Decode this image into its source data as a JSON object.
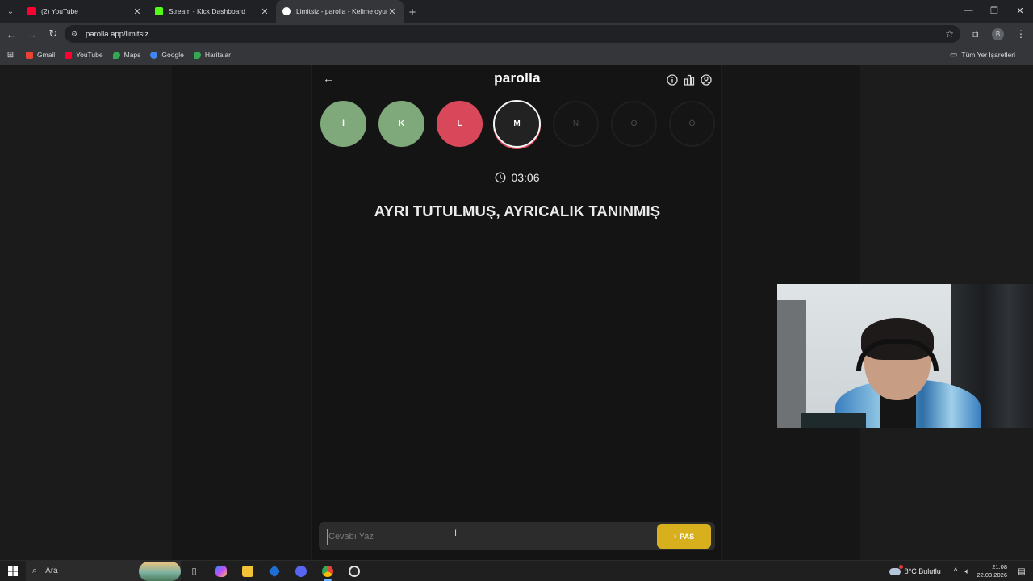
{
  "browser": {
    "tabs": [
      {
        "title": "(2) YouTube",
        "favicon_color": "#ff0033",
        "active": false
      },
      {
        "title": "Stream - Kick Dashboard",
        "favicon_color": "#53fc18",
        "active": false
      },
      {
        "title": "Limitsiz - parolla - Kelime oyunu",
        "favicon_color": "#ffffff",
        "active": true
      }
    ],
    "new_tab": "+",
    "url": "parolla.app/limitsiz",
    "profile_initial": "B",
    "bookmarks": [
      {
        "label": "Gmail",
        "color": "#ea4335"
      },
      {
        "label": "YouTube",
        "color": "#ff0033"
      },
      {
        "label": "Maps",
        "color": "#34a853"
      },
      {
        "label": "Google",
        "color": "#4285f4"
      },
      {
        "label": "Haritalar",
        "color": "#34a853"
      }
    ],
    "all_bookmarks": "Tüm Yer İşaretleri"
  },
  "app": {
    "logo": "parolla",
    "letters": [
      {
        "char": "İ",
        "state": "correct"
      },
      {
        "char": "K",
        "state": "correct"
      },
      {
        "char": "L",
        "state": "wrong"
      },
      {
        "char": "M",
        "state": "current"
      },
      {
        "char": "N",
        "state": "pending"
      },
      {
        "char": "O",
        "state": "pending"
      },
      {
        "char": "Ö",
        "state": "pending"
      }
    ],
    "timer": "03:06",
    "question": "AYRI TUTULMUŞ, AYRICALIK TANINMIŞ",
    "answer_placeholder": "Cevabı Yaz",
    "answer_value": "",
    "pass_label": "PAS",
    "colors": {
      "correct": "#7fa97a",
      "wrong": "#d9475b",
      "pass": "#d8b01e"
    }
  },
  "taskbar": {
    "search_label": "Ara",
    "weather": "8°C  Bulutlu",
    "time": "21:08",
    "date": "22.03.2026"
  }
}
